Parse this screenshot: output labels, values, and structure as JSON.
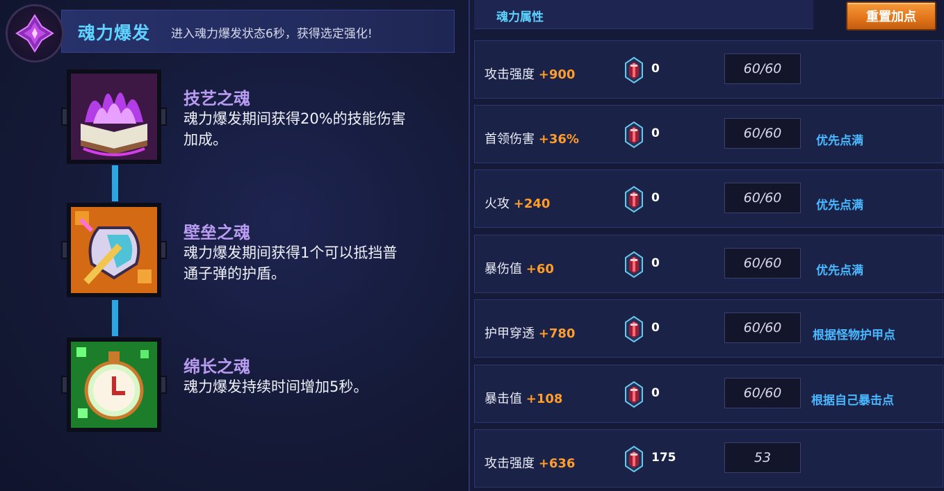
{
  "burst": {
    "title": "魂力爆发",
    "desc": "进入魂力爆发状态6秒，获得选定强化!"
  },
  "skills": [
    {
      "name": "技艺之魂",
      "line1": "魂力爆发期间获得20%的技能伤害",
      "line2": "加成。",
      "icon": "purple-flame-book-icon"
    },
    {
      "name": "壁垒之魂",
      "line1": "魂力爆发期间获得1个可以抵挡普",
      "line2": "通子弹的护盾。",
      "icon": "shield-sword-icon"
    },
    {
      "name": "绵长之魂",
      "line1": "魂力爆发持续时间增加5秒。",
      "line2": "",
      "icon": "green-clock-icon"
    }
  ],
  "attr": {
    "title": "魂力属性",
    "reset_label": "重置加点",
    "rows": [
      {
        "label": "攻击强度",
        "bonus": "+900",
        "gems": "0",
        "level": "60/60",
        "note": ""
      },
      {
        "label": "首领伤害",
        "bonus": "+36%",
        "gems": "0",
        "level": "60/60",
        "note": "优先点满"
      },
      {
        "label": "火攻",
        "bonus": "+240",
        "gems": "0",
        "level": "60/60",
        "note": "优先点满"
      },
      {
        "label": "暴伤值",
        "bonus": "+60",
        "gems": "0",
        "level": "60/60",
        "note": "优先点满"
      },
      {
        "label": "护甲穿透",
        "bonus": "+780",
        "gems": "0",
        "level": "60/60",
        "note": "根据怪物护甲点"
      },
      {
        "label": "暴击值",
        "bonus": "+108",
        "gems": "0",
        "level": "60/60",
        "note": "根据自己暴击点"
      },
      {
        "label": "攻击强度",
        "bonus": "+636",
        "gems": "175",
        "level": "53",
        "note": ""
      }
    ]
  },
  "colors": {
    "accent_cyan": "#5ed3ff",
    "bonus_orange": "#ff9d2a",
    "skill_name_purple": "#b99cf2",
    "note_blue": "#4ab8ff",
    "reset_orange": "#e2741a"
  }
}
